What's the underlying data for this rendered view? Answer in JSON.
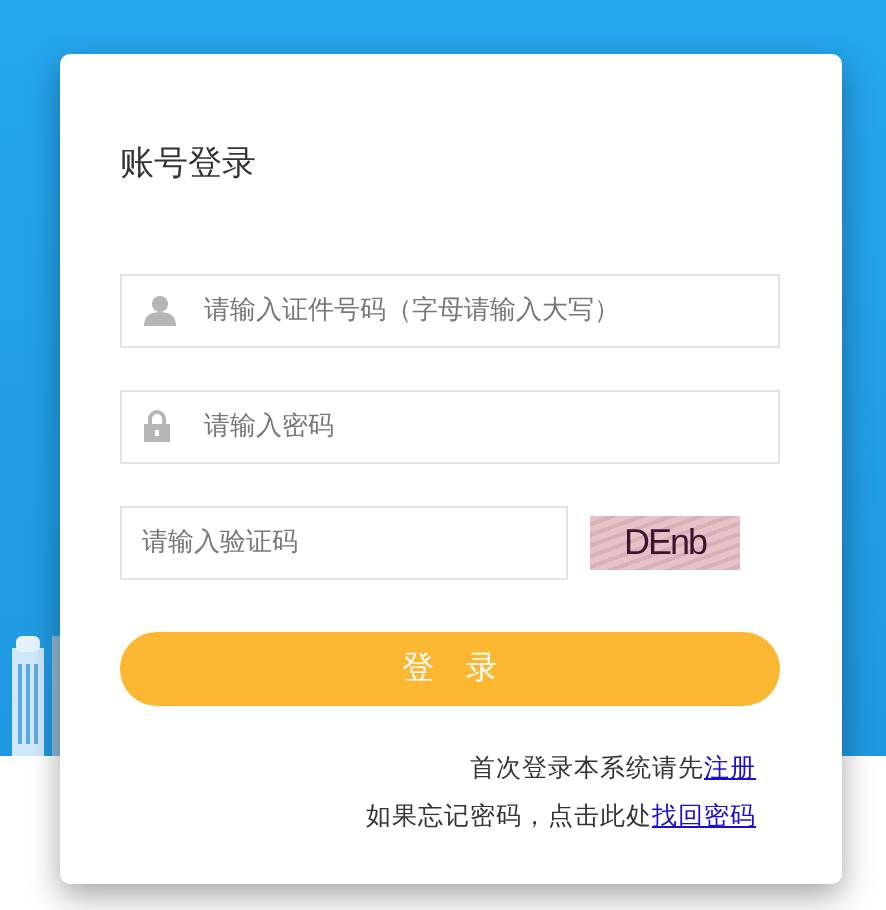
{
  "title": "账号登录",
  "fields": [
    {
      "kind": "user",
      "placeholder": "请输入证件号码（字母请输入大写）"
    },
    {
      "kind": "password",
      "placeholder": "请输入密码"
    }
  ],
  "captcha": {
    "placeholder": "请输入验证码",
    "image_text": "DEnb"
  },
  "login_button": "登　录",
  "footer": [
    {
      "text": "首次登录本系统请先",
      "link": "注册"
    },
    {
      "text": "如果忘记密码，点击此处",
      "link": "找回密码"
    }
  ]
}
